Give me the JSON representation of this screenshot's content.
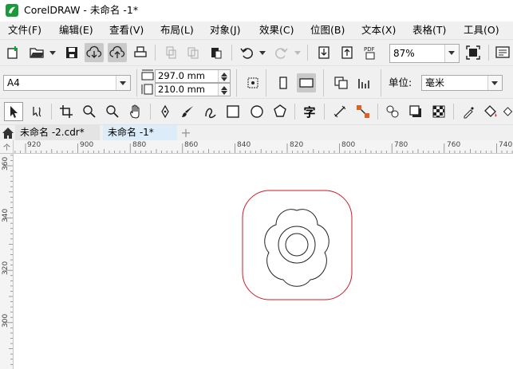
{
  "window": {
    "title": "CorelDRAW - 未命名 -1*"
  },
  "menu": [
    "文件(F)",
    "编辑(E)",
    "查看(V)",
    "布局(L)",
    "对象(J)",
    "效果(C)",
    "位图(B)",
    "文本(X)",
    "表格(T)",
    "工具(O)"
  ],
  "toolbar": {
    "zoom": "87%"
  },
  "property_bar": {
    "page_size": "A4",
    "width": "297.0 mm",
    "height": "210.0 mm",
    "units_label": "单位:",
    "units_value": "毫米"
  },
  "toolbox": {
    "text_tool_glyph": "字"
  },
  "tabs": [
    {
      "label": "未命名 -2.cdr*",
      "active": false
    },
    {
      "label": "未命名 -1*",
      "active": true
    }
  ],
  "ruler": {
    "h_labels": [
      "920",
      "900",
      "880",
      "860",
      "840",
      "820",
      "800",
      "780",
      "760",
      "740"
    ],
    "v_labels": [
      "360",
      "340",
      "320",
      "300"
    ],
    "corner_glyph": "个"
  },
  "colors": {
    "accent_green": "#1a9b3b",
    "active_tab": "#dcecf9",
    "outline_red": "#d11a2a",
    "shape_stroke": "#222222"
  },
  "icons": [
    "new-document-icon",
    "open-folder-icon",
    "save-icon",
    "cloud-download-icon",
    "cloud-upload-icon",
    "print-icon",
    "cut-icon",
    "copy-icon",
    "paste-icon",
    "undo-icon",
    "redo-icon",
    "import-icon",
    "export-icon",
    "pdf-export-icon",
    "full-screen-icon",
    "application-launcher-icon"
  ]
}
